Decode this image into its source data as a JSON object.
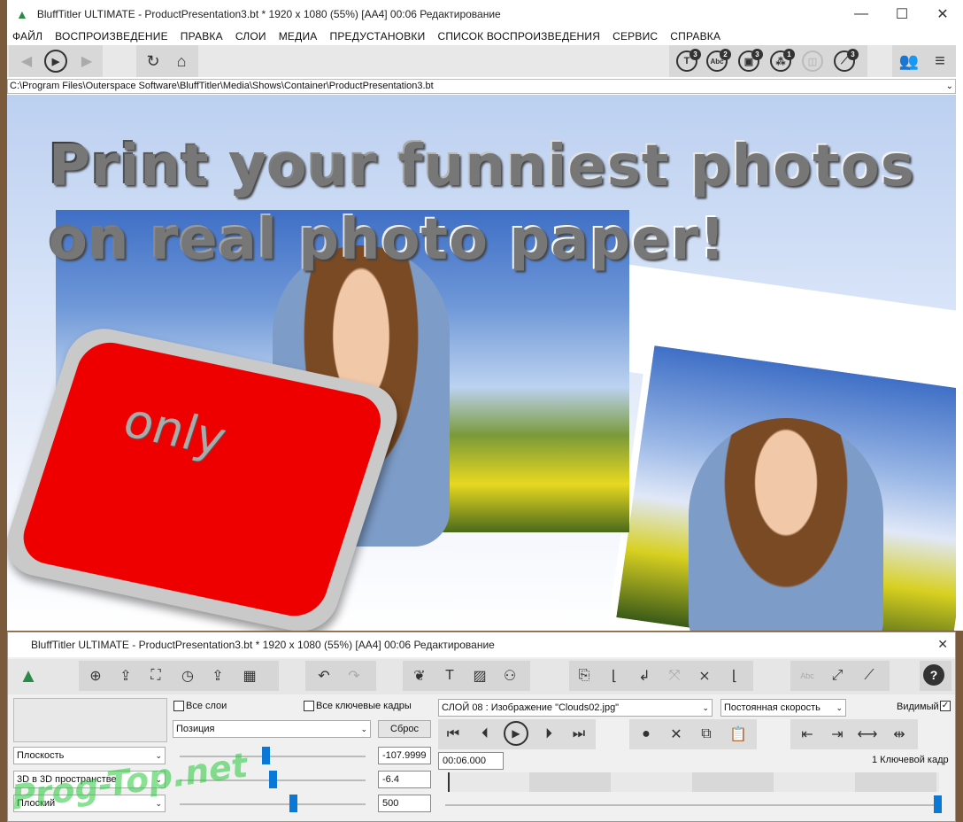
{
  "window_top": {
    "title": "BluffTitler ULTIMATE  - ProductPresentation3.bt * 1920 x 1080 (55%) [AA4] 00:06 Редактирование",
    "menu": [
      "ФАЙЛ",
      "ВОСПРОИЗВЕДЕНИЕ",
      "ПРАВКА",
      "СЛОИ",
      "МЕДИА",
      "ПРЕДУСТАНОВКИ",
      "СПИСОК ВОСПРОИЗВЕДЕНИЯ",
      "СЕРВИС",
      "СПРАВКА"
    ],
    "badges": {
      "text": "3",
      "abc": "2",
      "image": "3",
      "nodes": "1",
      "wand": "3"
    },
    "path": "C:\\Program Files\\Outerspace Software\\BluffTitler\\Media\\Shows\\Container\\ProductPresentation3.bt"
  },
  "stage": {
    "headline_line1": "Print your funniest photos",
    "headline_line2": "on real photo paper!",
    "button_text": "only"
  },
  "window_bottom": {
    "title": "BluffTitler ULTIMATE  - ProductPresentation3.bt * 1920 x 1080 (55%) [AA4] 00:06 Редактирование",
    "all_layers_label": "Все слои",
    "all_keyframes_label": "Все ключевые кадры",
    "property_select": "Позиция",
    "reset_label": "Сброс",
    "layer_select": "СЛОЙ 08        : Изображение \"Clouds02.jpg\"",
    "speed_select": "Постоянная скорость",
    "visible_label": "Видимый",
    "row1_select": "Плоскость",
    "row2_select": "3D в 3D пространстве",
    "row3_select": "Плоский",
    "row1_value": "-107.9999",
    "row2_value": "-6.4",
    "row3_value": "500",
    "time_value": "00:06.000",
    "keyframe_count": "1 Ключевой кадр",
    "slider1_level": 0.46,
    "slider2_level": 0.5,
    "slider3_level": 0.61
  },
  "watermark": "Prog-Top.net"
}
